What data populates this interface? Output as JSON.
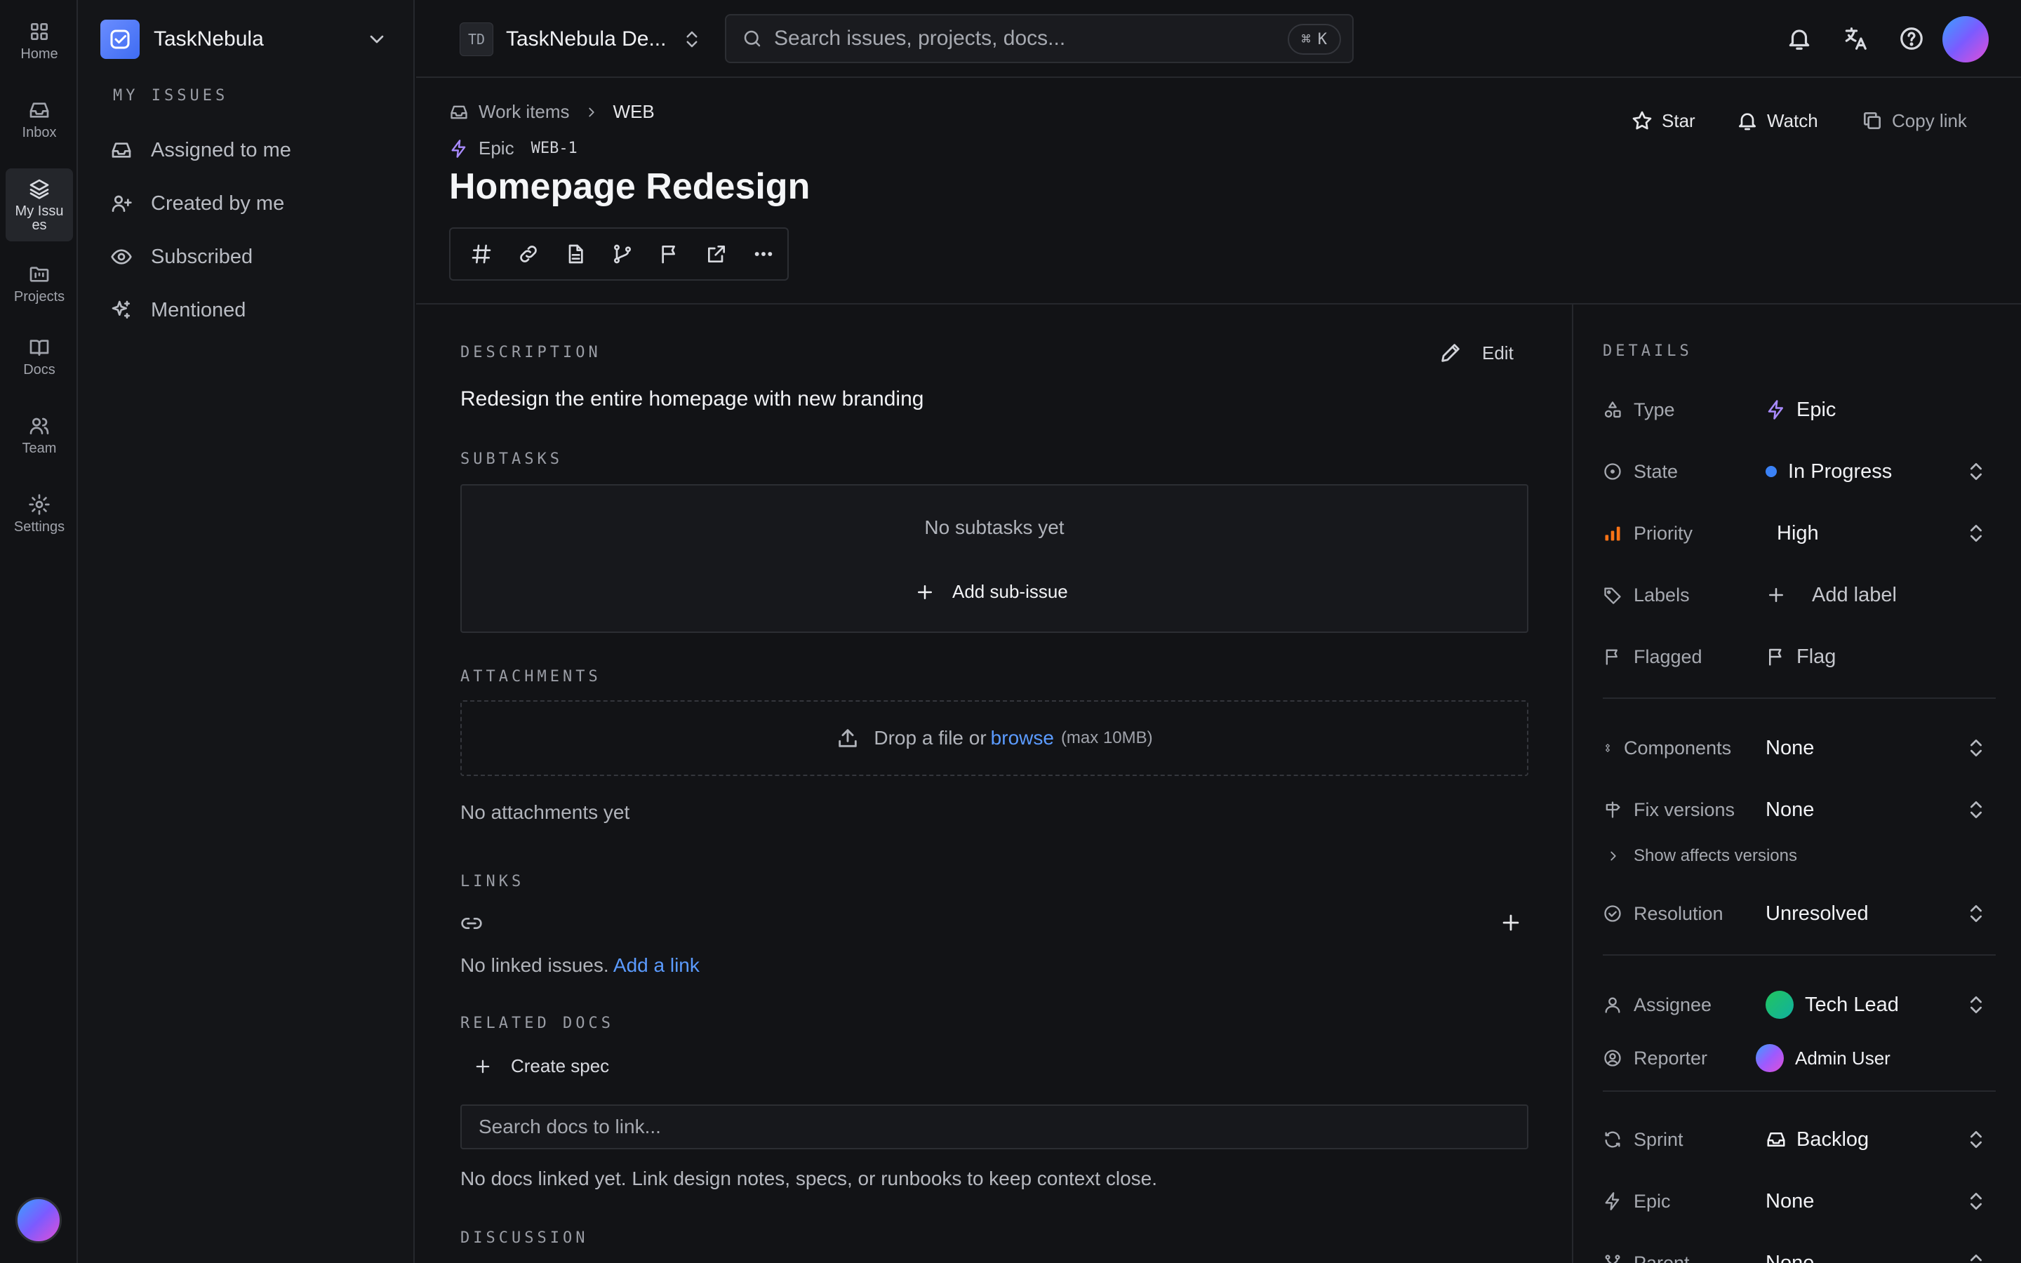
{
  "rail": {
    "items": [
      {
        "label": "Home",
        "icon": "grid-icon"
      },
      {
        "label": "Inbox",
        "icon": "inbox-icon"
      },
      {
        "label": "My Issues",
        "icon": "layers-icon"
      },
      {
        "label": "Projects",
        "icon": "folder-kanban-icon"
      },
      {
        "label": "Docs",
        "icon": "book-open-icon"
      },
      {
        "label": "Team",
        "icon": "users-icon"
      },
      {
        "label": "Settings",
        "icon": "gear-icon"
      }
    ]
  },
  "sidebar": {
    "workspace_name": "TaskNebula",
    "section_title": "MY ISSUES",
    "items": [
      {
        "label": "Assigned to me",
        "icon": "inbox-icon"
      },
      {
        "label": "Created by me",
        "icon": "user-plus-icon"
      },
      {
        "label": "Subscribed",
        "icon": "eye-icon"
      },
      {
        "label": "Mentioned",
        "icon": "sparkles-icon"
      }
    ]
  },
  "topbar": {
    "project_badge": "TD",
    "project_name": "TaskNebula De...",
    "search_placeholder": "Search issues, projects, docs...",
    "shortcut_symbol": "⌘",
    "shortcut_key": "K"
  },
  "issue": {
    "breadcrumb": [
      "Work items",
      "WEB"
    ],
    "type_label": "Epic",
    "key": "WEB-1",
    "title": "Homepage Redesign",
    "actions": {
      "star": "Star",
      "watch": "Watch",
      "copy_link": "Copy link"
    }
  },
  "main": {
    "description_head": "DESCRIPTION",
    "edit_label": "Edit",
    "description": "Redesign the entire homepage with new branding",
    "subtasks_head": "SUBTASKS",
    "subtasks_empty": "No subtasks yet",
    "add_sub_issue": "Add sub-issue",
    "attachments_head": "ATTACHMENTS",
    "drop_text": "Drop a file or",
    "browse": "browse",
    "drop_limit": "(max 10MB)",
    "attachments_empty": "No attachments yet",
    "links_head": "LINKS",
    "links_empty": "No linked issues.",
    "add_link": "Add a link",
    "related_docs_head": "RELATED DOCS",
    "create_spec": "Create spec",
    "docs_search_placeholder": "Search docs to link...",
    "docs_empty": "No docs linked yet. Link design notes, specs, or runbooks to keep context close.",
    "discussion_head": "DISCUSSION"
  },
  "details": {
    "title": "DETAILS",
    "type": {
      "label": "Type",
      "value": "Epic"
    },
    "state": {
      "label": "State",
      "value": "In Progress",
      "color": "#3b82f6"
    },
    "priority": {
      "label": "Priority",
      "value": "High",
      "color": "#f97316"
    },
    "labels": {
      "label": "Labels",
      "value": "Add label"
    },
    "flagged": {
      "label": "Flagged",
      "value": "Flag"
    },
    "components": {
      "label": "Components",
      "value": "None"
    },
    "fix_versions": {
      "label": "Fix versions",
      "value": "None"
    },
    "show_affects": "Show affects versions",
    "resolution": {
      "label": "Resolution",
      "value": "Unresolved"
    },
    "assignee": {
      "label": "Assignee",
      "value": "Tech Lead"
    },
    "reporter": {
      "label": "Reporter",
      "value": "Admin User"
    },
    "sprint": {
      "label": "Sprint",
      "value": "Backlog"
    },
    "epic": {
      "label": "Epic",
      "value": "None"
    },
    "parent": {
      "label": "Parent",
      "value": "None"
    }
  },
  "colors": {
    "accent": "#5b9bff",
    "epic": "#a98bff",
    "background": "#121316"
  }
}
